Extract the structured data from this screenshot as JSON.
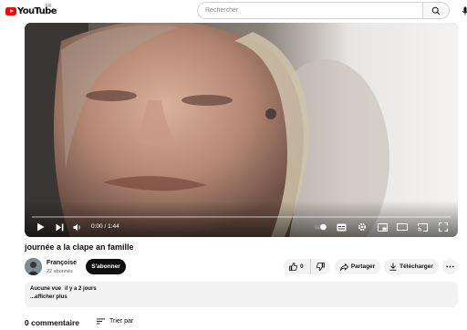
{
  "header": {
    "logo_text": "YouTube",
    "region": "FR",
    "search_placeholder": "Rechercher"
  },
  "player": {
    "time_display": "0:00 / 1:44",
    "progress": 0,
    "accent_color": "#ff0000"
  },
  "video": {
    "title": "journée a la clape an famille"
  },
  "channel": {
    "name": "Françoise",
    "subscribers": "22 abonnés",
    "subscribe_label": "S'abonner"
  },
  "actions": {
    "likes": "0",
    "share_label": "Partager",
    "download_label": "Télécharger"
  },
  "description": {
    "views": "Aucune vue",
    "date": "il y a 2 jours",
    "more_label": "...afficher plus"
  },
  "comments": {
    "count_label": "0 commentaire",
    "sort_label": "Trier par"
  },
  "icons": [
    "youtube-logo-icon",
    "search-icon",
    "mic-icon",
    "play-icon",
    "next-icon",
    "volume-icon",
    "autoplay-toggle-icon",
    "subtitles-icon",
    "settings-icon",
    "miniplayer-icon",
    "theater-icon",
    "cast-icon",
    "fullscreen-icon",
    "thumbs-up-icon",
    "thumbs-down-icon",
    "share-icon",
    "download-icon",
    "more-icon",
    "sort-icon"
  ]
}
